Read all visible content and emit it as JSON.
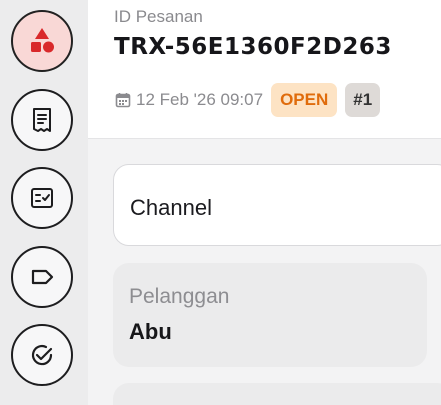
{
  "sidebar": {
    "items": [
      {
        "icon": "shapes-icon",
        "active": true
      },
      {
        "icon": "receipt-icon",
        "active": false
      },
      {
        "icon": "checklist-icon",
        "active": false
      },
      {
        "icon": "tag-icon",
        "active": false
      },
      {
        "icon": "check-circle-icon",
        "active": false
      }
    ]
  },
  "order": {
    "label": "ID Pesanan",
    "id": "TRX-56E1360F2D263",
    "timestamp": "12 Feb '26 09:07",
    "status": "OPEN",
    "number_badge": "#1"
  },
  "fields": {
    "channel_label": "Channel",
    "customer_label": "Pelanggan",
    "customer_value": "Abu"
  },
  "colors": {
    "active_nav_bg": "#f9d8d6",
    "status_open_bg": "#fde3c4",
    "status_open_text": "#e06c0c"
  }
}
